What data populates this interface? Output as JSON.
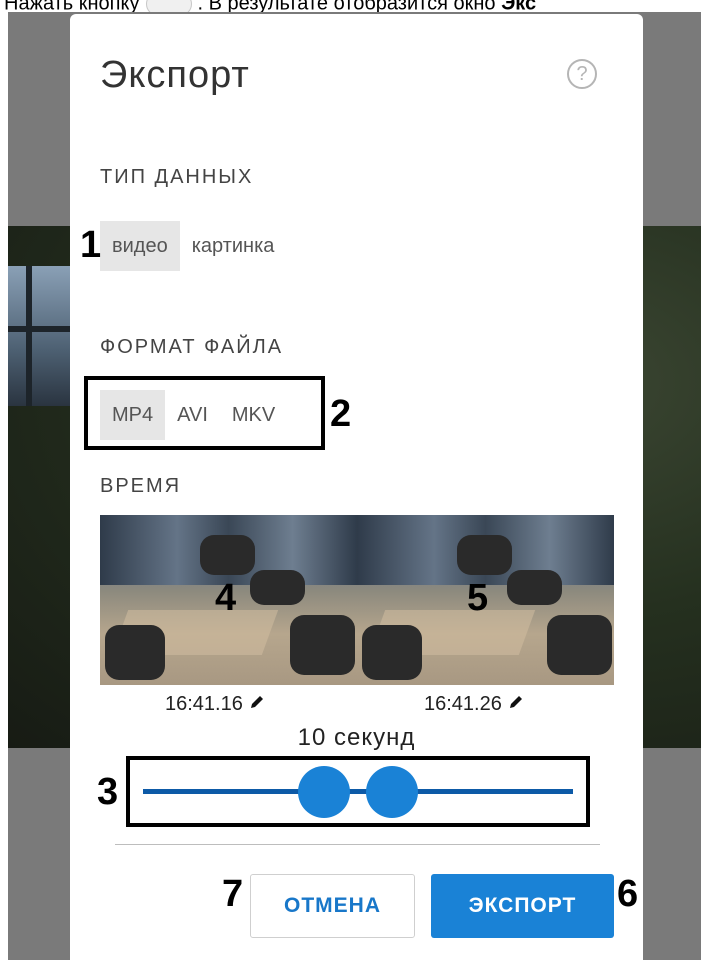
{
  "top_caption": {
    "before": "Нажать кнопку",
    "after": ". В результате отобразится окно",
    "bold": "Экс"
  },
  "dialog": {
    "title": "Экспорт",
    "help_glyph": "?",
    "data_type": {
      "label": "ТИП ДАННЫХ",
      "options": [
        "видео",
        "картинка"
      ],
      "selected": "видео"
    },
    "file_format": {
      "label": "ФОРМАТ ФАЙЛА",
      "options": [
        "MP4",
        "AVI",
        "MKV"
      ],
      "selected": "MP4"
    },
    "time": {
      "label": "ВРЕМЯ",
      "start_time": "16:41.16",
      "end_time": "16:41.26",
      "duration": "10 секунд",
      "range_start_fraction": 0.42,
      "range_end_fraction": 0.58
    },
    "buttons": {
      "cancel": "ОТМЕНА",
      "export": "ЭКСПОРТ"
    }
  },
  "annotations": {
    "n1": "1",
    "n2": "2",
    "n3": "3",
    "n4": "4",
    "n5": "5",
    "n6": "6",
    "n7": "7"
  },
  "colors": {
    "accent": "#1a82d6",
    "track": "#0d5aa7",
    "selected_option_bg": "#e6e6e6"
  },
  "icons": {
    "help": "help-circle-icon",
    "edit": "pencil-icon"
  }
}
